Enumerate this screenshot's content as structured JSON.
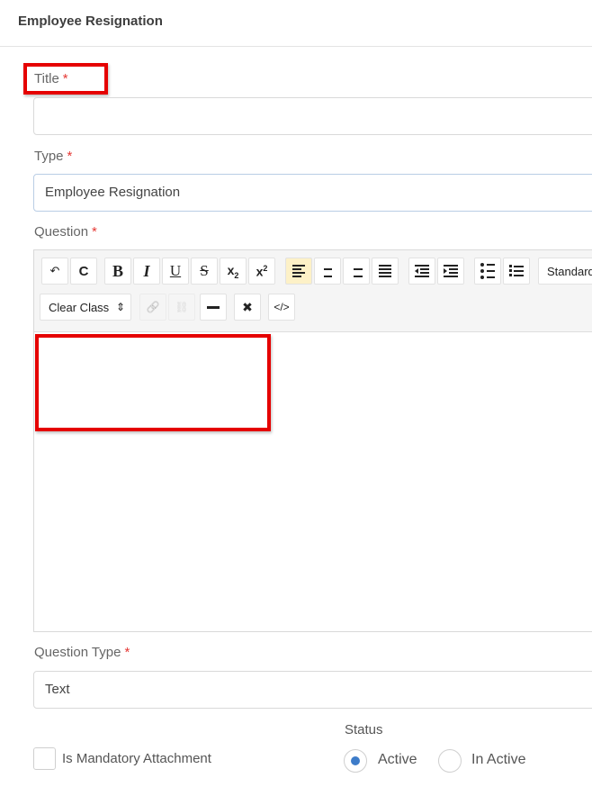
{
  "header": {
    "title": "Employee Resignation"
  },
  "form": {
    "title": {
      "label": "Title",
      "required_mark": "*",
      "value": ""
    },
    "type": {
      "label": "Type",
      "required_mark": "*",
      "value": "Employee Resignation"
    },
    "question": {
      "label": "Question",
      "required_mark": "*"
    },
    "question_type": {
      "label": "Question Type",
      "required_mark": "*",
      "value": "Text"
    },
    "status": {
      "label": "Status",
      "options": [
        {
          "label": "Active",
          "selected": true
        },
        {
          "label": "In Active",
          "selected": false
        }
      ]
    },
    "mandatory_attachment": {
      "label": "Is Mandatory Attachment",
      "checked": false
    }
  },
  "toolbar": {
    "undo": "↶",
    "redo": "C",
    "bold": "B",
    "italic": "I",
    "underline": "U",
    "strike": "S",
    "subscript": "x",
    "subscript_sub": "2",
    "superscript": "x",
    "superscript_sup": "2",
    "format_select": "Standard",
    "class_select": "Clear Class",
    "class_select_arrow": "⇕",
    "link": "🔗",
    "unlink": "⛓",
    "hr": "—",
    "remove_format": "✖",
    "source": "</>"
  },
  "colors": {
    "highlight": "#e50000",
    "required": "#e53935",
    "radio_selected": "#3d7cc9",
    "active_tool": "#fdf1c7"
  }
}
